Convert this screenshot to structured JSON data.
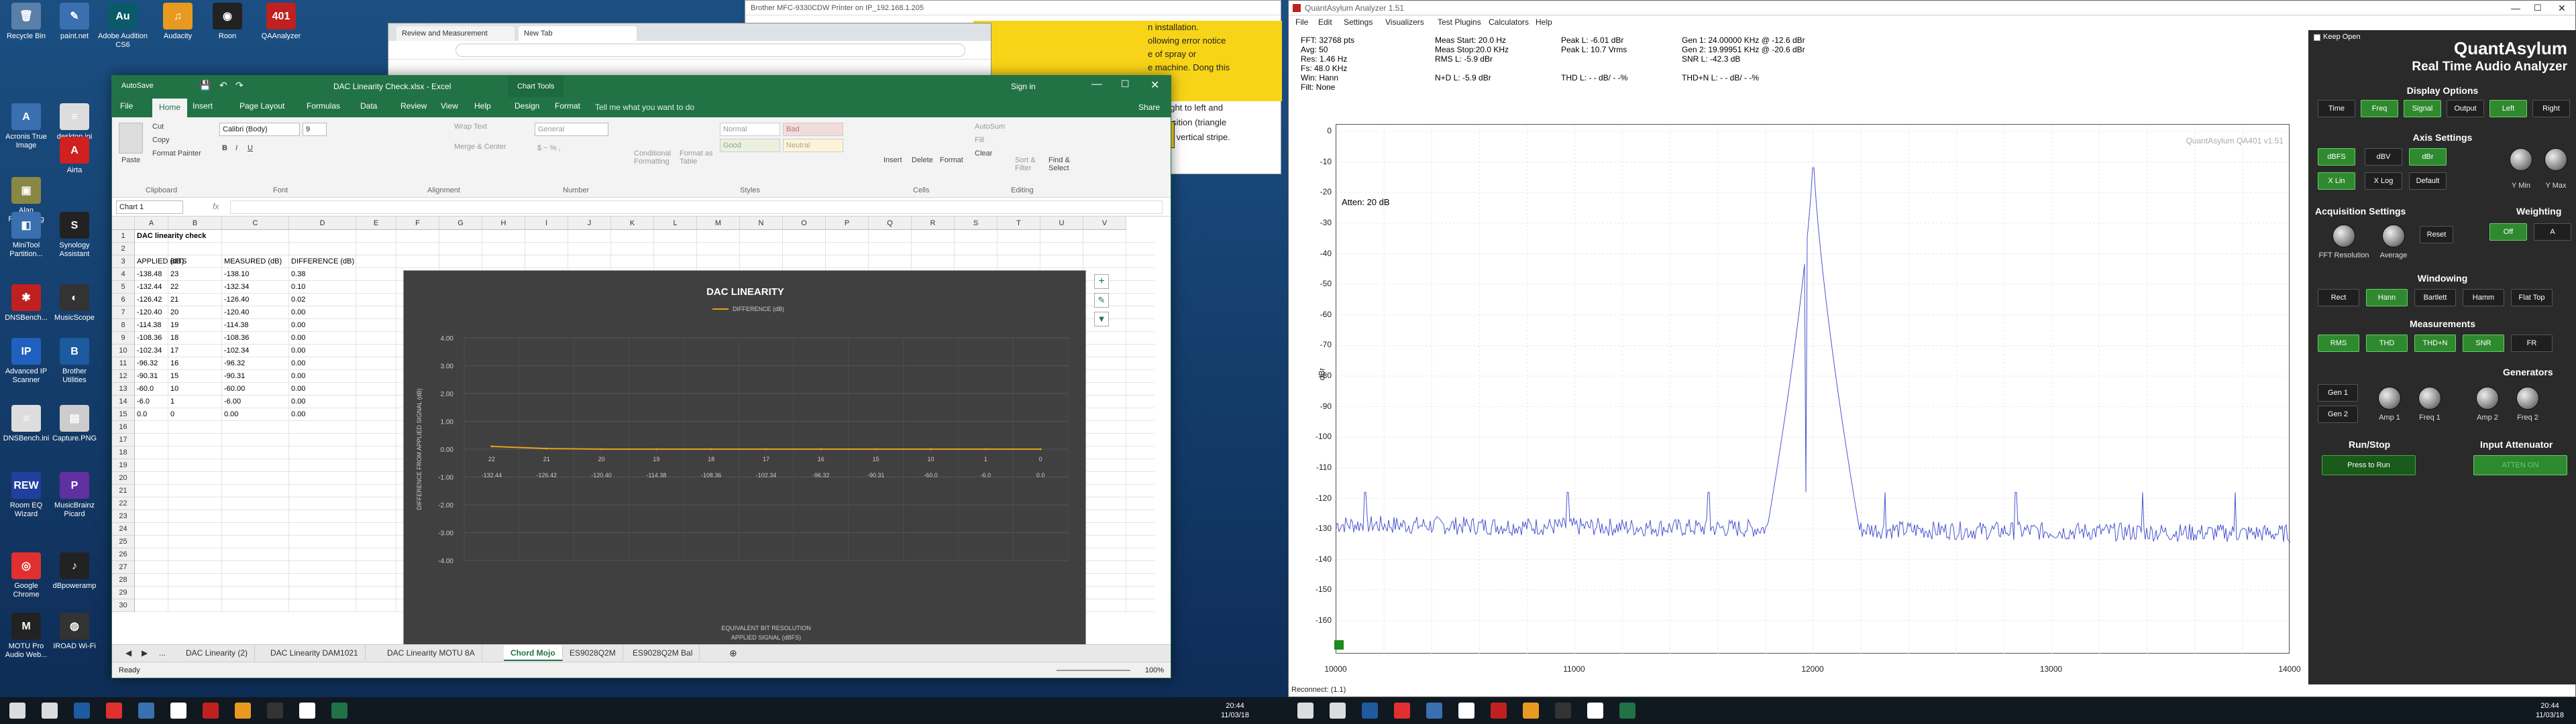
{
  "desktop": {
    "icons": [
      {
        "label": "Recycle Bin",
        "color": "#5a7fa8",
        "glyph": "🗑"
      },
      {
        "label": "paint.net",
        "color": "#3a6fb0",
        "glyph": "✎"
      },
      {
        "label": "Adobe Audition CS6",
        "color": "#0a5a6a",
        "glyph": "Au"
      },
      {
        "label": "Audacity",
        "color": "#e89a20",
        "glyph": "♫"
      },
      {
        "label": "Roon",
        "color": "#222",
        "glyph": "◉"
      },
      {
        "label": "QAAnalyzer",
        "color": "#c02020",
        "glyph": "401"
      },
      {
        "label": "Acronis True Image",
        "color": "#3a6fb0",
        "glyph": "A"
      },
      {
        "label": "desktop.ini",
        "color": "#ddd",
        "glyph": "≡"
      },
      {
        "label": "Alan Portrait.jpg",
        "color": "#884",
        "glyph": "▣"
      },
      {
        "label": "Airta",
        "color": "#d02020",
        "glyph": "A"
      },
      {
        "label": "MiniTool Partition...",
        "color": "#3a6fb0",
        "glyph": "◧"
      },
      {
        "label": "Synology Assistant",
        "color": "#222",
        "glyph": "S"
      },
      {
        "label": "DNSBench...",
        "color": "#c02020",
        "glyph": "✱"
      },
      {
        "label": "MusicScope",
        "color": "#333",
        "glyph": "◐"
      },
      {
        "label": "Advanced IP Scanner",
        "color": "#2060c0",
        "glyph": "IP"
      },
      {
        "label": "Brother Utilities",
        "color": "#1e5aa0",
        "glyph": "B"
      },
      {
        "label": "DNSBench.ini",
        "color": "#ddd",
        "glyph": "≡"
      },
      {
        "label": "Capture.PNG",
        "color": "#ccc",
        "glyph": "▤"
      },
      {
        "label": "Room EQ Wizard",
        "color": "#2040a0",
        "glyph": "REW"
      },
      {
        "label": "MusicBrainz Picard",
        "color": "#6030a0",
        "glyph": "P"
      },
      {
        "label": "Google Chrome",
        "color": "#e03030",
        "glyph": "◎"
      },
      {
        "label": "dBpoweramp",
        "color": "#222",
        "glyph": "♪"
      },
      {
        "label": "MOTU Pro Audio Web...",
        "color": "#222",
        "glyph": "M"
      },
      {
        "label": "IROAD Wi-Fi",
        "color": "#333",
        "glyph": "◍"
      }
    ]
  },
  "printer_window": {
    "title": "Brother MFC-9330CDW Printer on IP_192.168.1.205",
    "lines": [
      "n installation.",
      "ollowing error notice",
      "e of spray or",
      "e machine. Dong this",
      "rom right to left and",
      "me position (triangle",
      "have a vertical stripe."
    ]
  },
  "browser": {
    "tab1": "Review and Measurement",
    "tab2": "New Tab"
  },
  "excel": {
    "autosave": "AutoSave",
    "title": "DAC Linearity Check.xlsx  -  Excel",
    "chart_tools": "Chart Tools",
    "signin": "Sign in",
    "tabs": [
      "File",
      "Home",
      "Insert",
      "Page Layout",
      "Formulas",
      "Data",
      "Review",
      "View",
      "Help",
      "Design",
      "Format"
    ],
    "tell_me": "Tell me what you want to do",
    "share": "Share",
    "ribbon": {
      "cut": "Cut",
      "copy": "Copy",
      "format_painter": "Format Painter",
      "paste": "Paste",
      "clipboard": "Clipboard",
      "font": "Font",
      "alignment": "Alignment",
      "number": "Number",
      "styles": "Styles",
      "cells": "Cells",
      "editing": "Editing",
      "font_name": "Calibri (Body)",
      "font_size": "9",
      "wrap": "Wrap Text",
      "merge": "Merge & Center",
      "numfmt": "General",
      "normal": "Normal",
      "bad": "Bad",
      "good": "Good",
      "neutral": "Neutral",
      "cond": "Conditional Formatting",
      "fmt_table": "Format as Table",
      "insert": "Insert",
      "delete": "Delete",
      "format": "Format",
      "autosum": "AutoSum",
      "fill": "Fill",
      "clear": "Clear",
      "sort": "Sort & Filter",
      "find": "Find & Select"
    },
    "namebox": "Chart 1",
    "columns": [
      "A",
      "B",
      "C",
      "D",
      "E",
      "F",
      "G",
      "H",
      "I",
      "J",
      "K",
      "L",
      "M",
      "N",
      "O",
      "P",
      "Q",
      "R",
      "S",
      "T",
      "U",
      "V"
    ],
    "title_cell": "DAC linearity check",
    "headers": [
      "APPLIED (dB)",
      "BITS",
      "MEASURED (dB)",
      "DIFFERENCE (dB)"
    ],
    "rows": [
      [
        "-138.48",
        "23",
        "-138.10",
        "0.38"
      ],
      [
        "-132.44",
        "22",
        "-132.34",
        "0.10"
      ],
      [
        "-126.42",
        "21",
        "-126.40",
        "0.02"
      ],
      [
        "-120.40",
        "20",
        "-120.40",
        "0.00"
      ],
      [
        "-114.38",
        "19",
        "-114.38",
        "0.00"
      ],
      [
        "-108.36",
        "18",
        "-108.36",
        "0.00"
      ],
      [
        "-102.34",
        "17",
        "-102.34",
        "0.00"
      ],
      [
        "-96.32",
        "16",
        "-96.32",
        "0.00"
      ],
      [
        "-90.31",
        "15",
        "-90.31",
        "0.00"
      ],
      [
        "-60.0",
        "10",
        "-60.00",
        "0.00"
      ],
      [
        "-6.0",
        "1",
        "-6.00",
        "0.00"
      ],
      [
        "0.0",
        "0",
        "0.00",
        "0.00"
      ]
    ],
    "sheet_tabs": [
      "DAC Linearity (2)",
      "DAC Linearity DAM1021",
      "DAC Linearity MOTU 8A",
      "Chord Mojo",
      "ES9028Q2M",
      "ES9028Q2M Bal"
    ],
    "active_sheet": "Chord Mojo",
    "status": "Ready",
    "zoom": "100%"
  },
  "chart_data": {
    "type": "line",
    "title": "DAC LINEARITY",
    "legend": [
      "DIFFERENCE (dB)"
    ],
    "ylabel": "DIFFERENCE FROM APPLIED SIGNAL (dB)",
    "xlabel_line1": "EQUIVALENT BIT  RESOLUTION",
    "xlabel_line2": "APPLIED SIGNAL (dBFS)",
    "ylim": [
      -4,
      4
    ],
    "yticks": [
      "4.00",
      "3.00",
      "2.00",
      "1.00",
      "0.00",
      "-1.00",
      "-2.00",
      "-3.00",
      "-4.00"
    ],
    "bits": [
      "22",
      "21",
      "20",
      "19",
      "18",
      "17",
      "16",
      "15",
      "10",
      "1",
      "0"
    ],
    "applied": [
      "-132.44",
      "-126.42",
      "-120.40",
      "-114.38",
      "-108.36",
      "-102.34",
      "-96.32",
      "-90.31",
      "-60.0",
      "-6.0",
      "0.0"
    ],
    "series": [
      {
        "name": "DIFFERENCE (dB)",
        "values": [
          0.1,
          0.02,
          0.0,
          0.0,
          0.0,
          0.0,
          0.0,
          0.0,
          0.0,
          0.0,
          0.0
        ],
        "color": "#e8a020"
      }
    ]
  },
  "qa": {
    "title": "QuantAsylum Analyzer 1.51",
    "menu": [
      "File",
      "Edit",
      "Settings",
      "Visualizers",
      "Test Plugins",
      "Calculators",
      "Help"
    ],
    "info_col1": [
      "FFT: 32768 pts",
      "Avg: 50",
      "Res: 1.46 Hz",
      "Fs: 48.0 KHz",
      "Win: Hann",
      "Filt: None"
    ],
    "info_col2": [
      "Meas Start: 20.0 Hz",
      "Meas Stop:20.0 KHz",
      "RMS L: -5.9 dBr",
      "",
      "N+D L: -5.9 dBr"
    ],
    "info_col3": [
      "Peak L: -6.01 dBr",
      "Peak L: 10.7 Vrms",
      "",
      "",
      "THD L: - - dB/ - -%"
    ],
    "info_col4": [
      "Gen 1: 24.00000 KHz @ -12.6  dBr",
      "Gen 2: 19.99951 KHz @ -20.6  dBr",
      "SNR L: -42.3 dB",
      "",
      "THD+N L: - - dB/ - -%"
    ],
    "watermark": "QuantAsylum QA401 v1.51",
    "atten": "Atten: 20 dB",
    "ylabel": "dBr",
    "reconnect": "Reconnect: (1.1)",
    "brand1": "QuantAsylum",
    "brand2": "Real Time Audio Analyzer",
    "keep_open": "Keep Open",
    "display_options": "Display Options",
    "disp_btns": [
      "Time",
      "Freq",
      "Signal",
      "Output",
      "Left",
      "Right"
    ],
    "axis_settings": "Axis Settings",
    "axis_btns": [
      "dBFS",
      "dBV",
      "dBr",
      "X Lin",
      "X Log",
      "Default"
    ],
    "ymin": "Y Min",
    "ymax": "Y Max",
    "acq": "Acquisition Settings",
    "fft_res": "FFT Resolution",
    "average": "Average",
    "reset": "Reset",
    "weighting": "Weighting",
    "w_off": "Off",
    "w_a": "A",
    "windowing": "Windowing",
    "win_btns": [
      "Rect",
      "Hann",
      "Bartlett",
      "Hamm",
      "Flat Top"
    ],
    "measurements": "Measurements",
    "meas_btns": [
      "RMS",
      "THD",
      "THD+N",
      "SNR",
      "FR"
    ],
    "generators": "Generators",
    "gen1": "Gen 1",
    "gen2": "Gen 2",
    "amp1": "Amp 1",
    "freq1": "Freq 1",
    "amp2": "Amp 2",
    "freq2": "Freq 2",
    "runstop": "Run/Stop",
    "press_run": "Press to Run",
    "input_att": "Input Attenuator",
    "att_btn": "ATTEN ON",
    "x_ticks": [
      "10000",
      "11000",
      "12000",
      "13000",
      "14000"
    ],
    "y_ticks": [
      "0",
      "-10",
      "-20",
      "-30",
      "-40",
      "-50",
      "-60",
      "-70",
      "-80",
      "-90",
      "-100",
      "-110",
      "-120",
      "-130",
      "-140",
      "-150",
      "-160"
    ]
  },
  "taskbar": {
    "time": "20:44",
    "date": "11/03/18"
  }
}
